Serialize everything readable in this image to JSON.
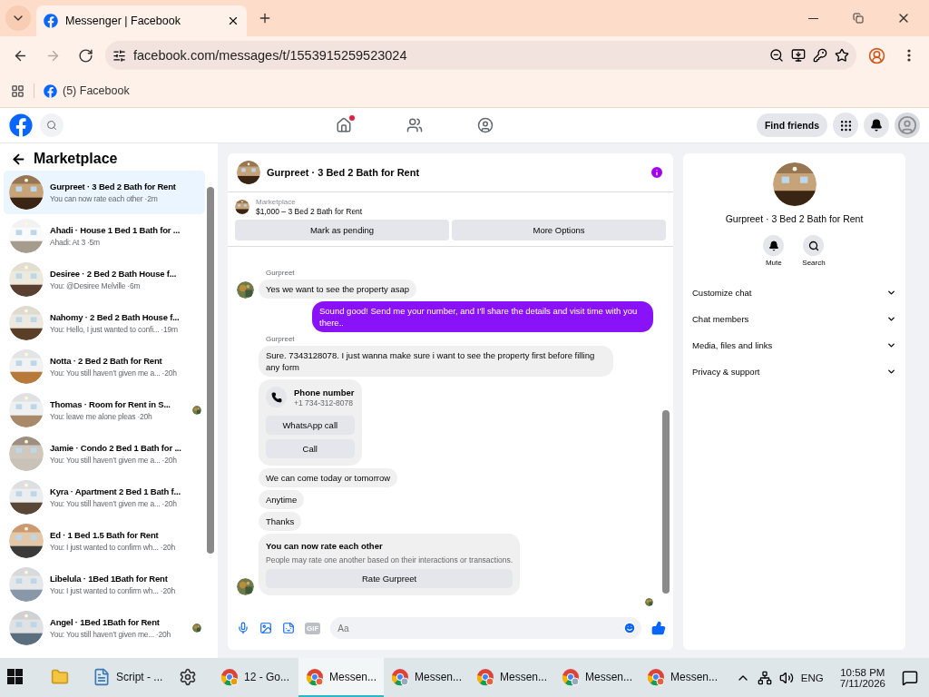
{
  "browser": {
    "tab_title": "Messenger | Facebook",
    "url": "facebook.com/messages/t/1553915259523024",
    "bookmark": "(5) Facebook",
    "nav_buttons": [
      {
        "kind": "back",
        "disabled": false
      },
      {
        "kind": "forward",
        "disabled": true
      },
      {
        "kind": "reload",
        "disabled": false
      }
    ]
  },
  "top_nav": {
    "icons": [
      {
        "kind": "home",
        "badge": true
      },
      {
        "kind": "friends",
        "badge": false
      },
      {
        "kind": "groups",
        "badge": false
      }
    ],
    "find_friends": "Find friends"
  },
  "sidebar": {
    "title": "Marketplace",
    "conversations": [
      {
        "title": "Gurpreet · 3 Bed 2 Bath for Rent",
        "preview": "You can now rate each other",
        "time": "·2m",
        "selected": true,
        "read_receipt": false
      },
      {
        "title": "Ahadi · House 1 Bed 1 Bath for ...",
        "preview": "Ahadi: At 3",
        "time": "·5m",
        "selected": false,
        "read_receipt": false
      },
      {
        "title": "Desiree · 2 Bed 2 Bath House f...",
        "preview": "You: @Desiree Melville",
        "time": "·6m",
        "selected": false,
        "read_receipt": false
      },
      {
        "title": "Nahomy · 2 Bed 2 Bath House f...",
        "preview": "You: Hello, I just wanted to confi...",
        "time": "·19m",
        "selected": false,
        "read_receipt": false
      },
      {
        "title": "Notta · 2 Bed 2 Bath for Rent",
        "preview": "You: You still haven’t given me a...",
        "time": "·20h",
        "selected": false,
        "read_receipt": false
      },
      {
        "title": "Thomas · Room for Rent in S...",
        "preview": "You: leave me alone pleas",
        "time": "·20h",
        "selected": false,
        "read_receipt": true
      },
      {
        "title": "Jamie · Condo 2 Bed 1 Bath for ...",
        "preview": "You: You still haven’t given me a...",
        "time": "·20h",
        "selected": false,
        "read_receipt": false
      },
      {
        "title": "Kyra · Apartment 2 Bed 1 Bath f...",
        "preview": "You: You still haven’t given me a...",
        "time": "·20h",
        "selected": false,
        "read_receipt": false
      },
      {
        "title": "Ed · 1 Bed 1.5 Bath for Rent",
        "preview": "You: I just wanted to confirm wh...",
        "time": "·20h",
        "selected": false,
        "read_receipt": false
      },
      {
        "title": "Libelula · 1Bed 1Bath for Rent",
        "preview": "You: I just wanted to confirm wh...",
        "time": "·20h",
        "selected": false,
        "read_receipt": false
      },
      {
        "title": "Angel · 1Bed 1Bath for Rent",
        "preview": "You: You still haven’t given me...",
        "time": "·20h",
        "selected": false,
        "read_receipt": true
      }
    ]
  },
  "chat": {
    "title": "Gurpreet · 3 Bed 2 Bath for Rent",
    "listing": {
      "source": "Marketplace",
      "title": "$1,000 – 3 Bed 2 Bath for Rent"
    },
    "actions": [
      "Mark as pending",
      "More Options"
    ],
    "messages": [
      {
        "kind": "name",
        "text": "Gurpreet"
      },
      {
        "kind": "incoming",
        "text": "Yes we want to see the property asap",
        "avatar": true
      },
      {
        "kind": "outgoing",
        "text": "Sound good! Send me your number, and I'll share the details and visit time with you there.."
      },
      {
        "kind": "name",
        "text": "Gurpreet"
      },
      {
        "kind": "incoming",
        "text": "Sure. 7343128078. I just wanna make sure i want to see the property first before filling any form",
        "avatar": false
      },
      {
        "kind": "contact",
        "title": "Phone number",
        "subtitle": "+1 734-312-8078",
        "buttons": [
          "WhatsApp call",
          "Call"
        ],
        "avatar": false
      },
      {
        "kind": "incoming",
        "text": "We can come today or tomorrow",
        "avatar": false
      },
      {
        "kind": "incoming",
        "text": "Anytime",
        "avatar": false
      },
      {
        "kind": "incoming",
        "text": "Thanks",
        "avatar": false
      },
      {
        "kind": "rating",
        "title": "You can now rate each other",
        "text": "People may rate one another based on their interactions or transactions.",
        "button": "Rate Gurpreet",
        "avatar": true
      }
    ],
    "read_receipt": true,
    "gif_label": "GIF",
    "placeholder": "Aa"
  },
  "info": {
    "title": "Gurpreet · 3 Bed 2 Bath for Rent",
    "actions": [
      {
        "kind": "mute",
        "label": "Mute"
      },
      {
        "kind": "search",
        "label": "Search"
      }
    ],
    "sections": [
      {
        "label": "Customize chat"
      },
      {
        "label": "Chat members"
      },
      {
        "label": "Media, files and links"
      },
      {
        "label": "Privacy & support"
      }
    ]
  },
  "taskbar": {
    "items": [
      {
        "kind": "explorer",
        "selected": false
      },
      {
        "kind": "notepad",
        "label": "Script - ...",
        "selected": false
      },
      {
        "kind": "settings",
        "selected": false
      },
      {
        "kind": "browser",
        "label": "12 - Go...",
        "selected": false
      },
      {
        "kind": "browser",
        "label": "Messen...",
        "selected": true
      },
      {
        "kind": "browser",
        "label": "Messen...",
        "selected": false
      },
      {
        "kind": "browser",
        "label": "Messen...",
        "selected": false
      },
      {
        "kind": "browser",
        "label": "Messen...",
        "selected": false
      },
      {
        "kind": "browser",
        "label": "Messen...",
        "selected": false
      }
    ],
    "language": "ENG",
    "time": "10:58 PM",
    "date": "7/11/2026"
  }
}
